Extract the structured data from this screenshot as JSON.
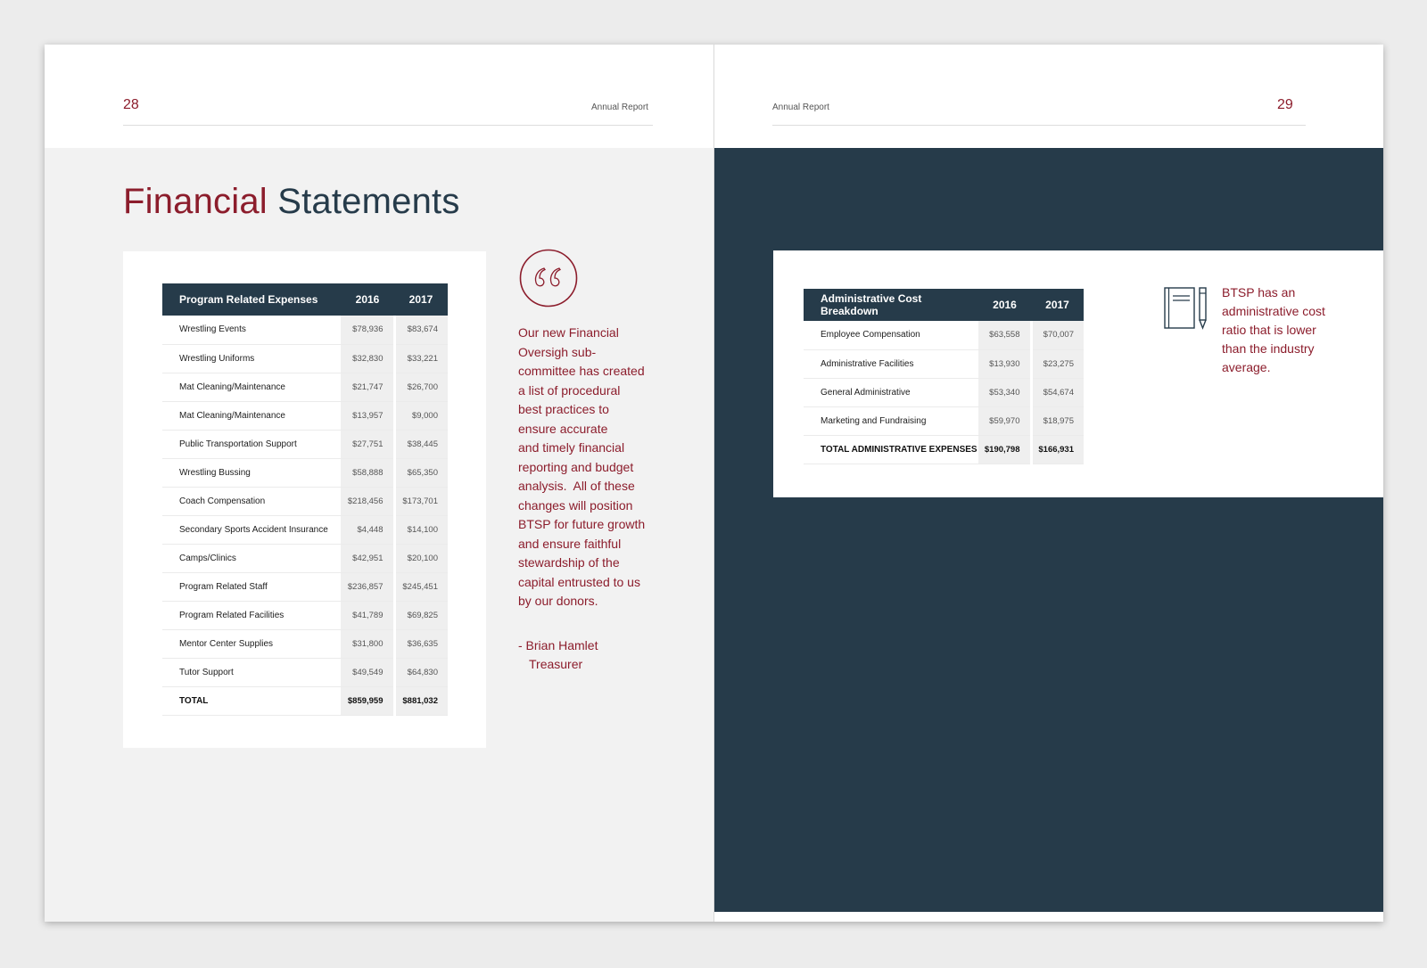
{
  "left_page": {
    "page_number": "28",
    "running_title": "Annual Report",
    "title_accent": "Financial",
    "title_main": "Statements",
    "program_table": {
      "headers": [
        "Program Related Expenses",
        "2016",
        "2017"
      ],
      "rows": [
        [
          "Wrestling Events",
          "$78,936",
          "$83,674"
        ],
        [
          "Wrestling Uniforms",
          "$32,830",
          "$33,221"
        ],
        [
          "Mat Cleaning/Maintenance",
          "$21,747",
          "$26,700"
        ],
        [
          "Mat Cleaning/Maintenance",
          "$13,957",
          "$9,000"
        ],
        [
          "Public Transportation Support",
          "$27,751",
          "$38,445"
        ],
        [
          "Wrestling Bussing",
          "$58,888",
          "$65,350"
        ],
        [
          "Coach Compensation",
          "$218,456",
          "$173,701"
        ],
        [
          "Secondary Sports Accident Insurance",
          "$4,448",
          "$14,100"
        ],
        [
          "Camps/Clinics",
          "$42,951",
          "$20,100"
        ],
        [
          "Program Related Staff",
          "$236,857",
          "$245,451"
        ],
        [
          "Program Related Facilities",
          "$41,789",
          "$69,825"
        ],
        [
          "Mentor Center Supplies",
          "$31,800",
          "$36,635"
        ],
        [
          "Tutor Support",
          "$49,549",
          "$64,830"
        ],
        [
          "TOTAL",
          "$859,959",
          "$881,032"
        ]
      ]
    },
    "quote": {
      "icon": "quote-marks-icon",
      "lines": [
        "Our new Financial",
        "Oversigh sub-",
        "committee has created",
        "a list of procedural",
        "best practices to",
        "ensure accurate",
        "and timely financial",
        "reporting and budget",
        "analysis.  All of these",
        "changes will position",
        "BTSP for future growth",
        "and ensure faithful",
        "stewardship of the",
        "capital entrusted to us",
        "by our donors."
      ],
      "author": "- Brian Hamlet",
      "role": "Treasurer"
    }
  },
  "right_page": {
    "page_number": "29",
    "running_title": "Annual Report",
    "admin_table": {
      "headers": [
        "Administrative Cost Breakdown",
        "2016",
        "2017"
      ],
      "rows": [
        [
          "Employee Compensation",
          "$63,558",
          "$70,007"
        ],
        [
          "Administrative Facilities",
          "$13,930",
          "$23,275"
        ],
        [
          "General Administrative",
          "$53,340",
          "$54,674"
        ],
        [
          "Marketing and Fundraising",
          "$59,970",
          "$18,975"
        ],
        [
          "TOTAL ADMINISTRATIVE EXPENSES",
          "$190,798",
          "$166,931"
        ]
      ]
    },
    "note": {
      "icon": "notebook-pencil-icon",
      "lines": [
        "BTSP has an",
        "administrative cost",
        "ratio that is lower",
        "than the industry",
        "average."
      ]
    }
  },
  "colors": {
    "accent": "#8c1d2c",
    "navy": "#263b4a",
    "page_background": "#f2f2f2"
  }
}
